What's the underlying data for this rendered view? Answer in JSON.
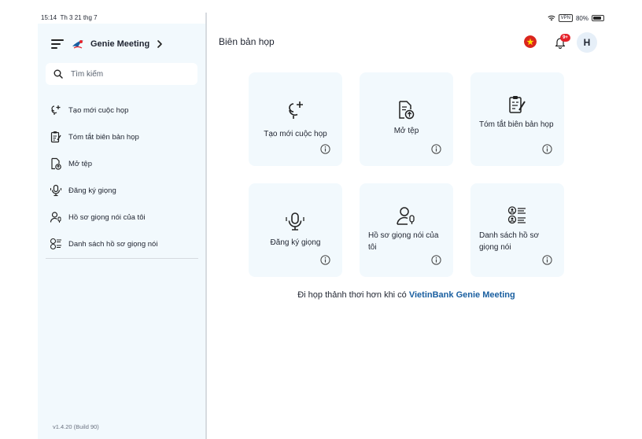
{
  "status_bar": {
    "time": "15:14",
    "date": "Th 3 21 thg 7",
    "vpn": "VPN",
    "battery": "80%"
  },
  "sidebar": {
    "app_name": "Genie Meeting",
    "search_placeholder": "Tìm kiếm",
    "items": [
      {
        "label": "Tạo mới cuộc họp",
        "icon": "mic-plus-icon"
      },
      {
        "label": "Tóm tắt biên bản họp",
        "icon": "clipboard-edit-icon"
      },
      {
        "label": "Mở tệp",
        "icon": "file-upload-icon"
      },
      {
        "label": "Đăng ký giọng",
        "icon": "mic-icon"
      },
      {
        "label": "Hồ sơ giọng nói của tôi",
        "icon": "user-mic-icon"
      },
      {
        "label": "Danh sách hồ sơ giọng nói",
        "icon": "user-list-icon"
      }
    ],
    "version": "v1.4.20 (Build 90)"
  },
  "header": {
    "title": "Biên bản họp",
    "notification_badge": "9+",
    "avatar_initial": "H"
  },
  "cards": [
    {
      "label": "Tạo mới cuộc họp",
      "icon": "mic-plus-icon"
    },
    {
      "label": "Mở tệp",
      "icon": "file-upload-icon"
    },
    {
      "label": "Tóm tắt biên bản họp",
      "icon": "clipboard-edit-icon"
    },
    {
      "label": "Đăng ký giọng",
      "icon": "mic-icon"
    },
    {
      "label": "Hồ sơ giọng nói của tôi",
      "icon": "user-mic-icon"
    },
    {
      "label": "Danh sách hồ sơ giọng nói",
      "icon": "user-list-icon"
    }
  ],
  "footer": {
    "text": "Đi họp thảnh thơi hơn khi có ",
    "brand": "VietinBank Genie Meeting"
  },
  "colors": {
    "card_bg": "#f2f9fd",
    "brand_blue": "#1a5fa0",
    "badge_red": "#e5222a",
    "flag_red": "#da251d",
    "flag_star": "#ffde00"
  }
}
